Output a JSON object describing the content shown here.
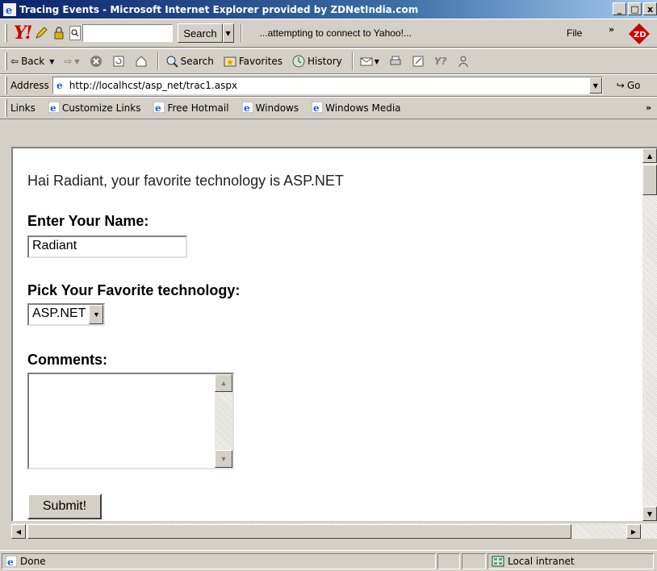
{
  "window": {
    "title": "Tracing Events - Microsoft Internet Explorer provided by ZDNetIndia.com",
    "min_label": "_",
    "max_label": "□",
    "close_label": "x"
  },
  "yahoo_bar": {
    "logo": "Y!",
    "search_value": "",
    "search_button": "Search",
    "status_text": "...attempting to connect to Yahoo!...",
    "file_menu": "File",
    "more_chevron": "»"
  },
  "std_toolbar": {
    "back": "Back",
    "search": "Search",
    "favorites": "Favorites",
    "history": "History"
  },
  "address_bar": {
    "label": "Address",
    "url": "http://localhcst/asp_net/trac1.aspx",
    "go": "Go"
  },
  "links_bar": {
    "label": "Links",
    "items": [
      "Customize Links",
      "Free Hotmail",
      "Windows",
      "Windows Media"
    ],
    "more_chevron": "»"
  },
  "page": {
    "greeting": "Hai Radiant, your favorite technology is ASP.NET",
    "name_label": "Enter Your Name:",
    "name_value": "Radiant",
    "tech_label": "Pick Your Favorite technology:",
    "tech_value": "ASP.NET",
    "comments_label": "Comments:",
    "comments_value": "",
    "submit_label": "Submit!"
  },
  "status_bar": {
    "text": "Done",
    "zone": "Local intranet"
  },
  "colors": {
    "titlebar_start": "#0a246a",
    "titlebar_end": "#a6caf0",
    "chrome": "#d4d0c8",
    "yahoo_red": "#cc0000"
  }
}
